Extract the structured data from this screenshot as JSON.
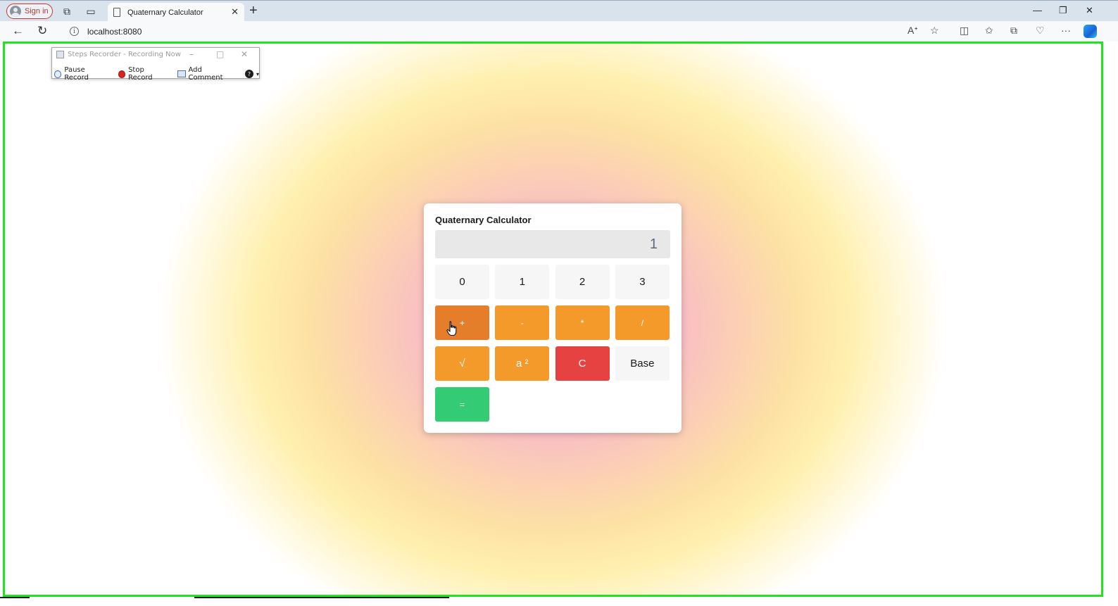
{
  "browser": {
    "sign_in_label": "Sign in",
    "tab_title": "Quaternary Calculator",
    "url": "localhost:8080",
    "accent_border": "#1ee51e"
  },
  "steps_recorder": {
    "title": "Steps Recorder - Recording Now",
    "pause_label": "Pause Record",
    "stop_label": "Stop Record",
    "comment_label": "Add Comment"
  },
  "calculator": {
    "title": "Quaternary Calculator",
    "display_value": "1",
    "keys": {
      "d0": "0",
      "d1": "1",
      "d2": "2",
      "d3": "3",
      "add": "+",
      "sub": "-",
      "mul": "*",
      "div": "/",
      "sqrt": "√",
      "square": "a ²",
      "clear": "C",
      "base": "Base",
      "equals": "="
    },
    "colors": {
      "operator": "#f39a2b",
      "operator_active": "#e47e2b",
      "clear": "#e74242",
      "equals": "#33cc74"
    }
  }
}
